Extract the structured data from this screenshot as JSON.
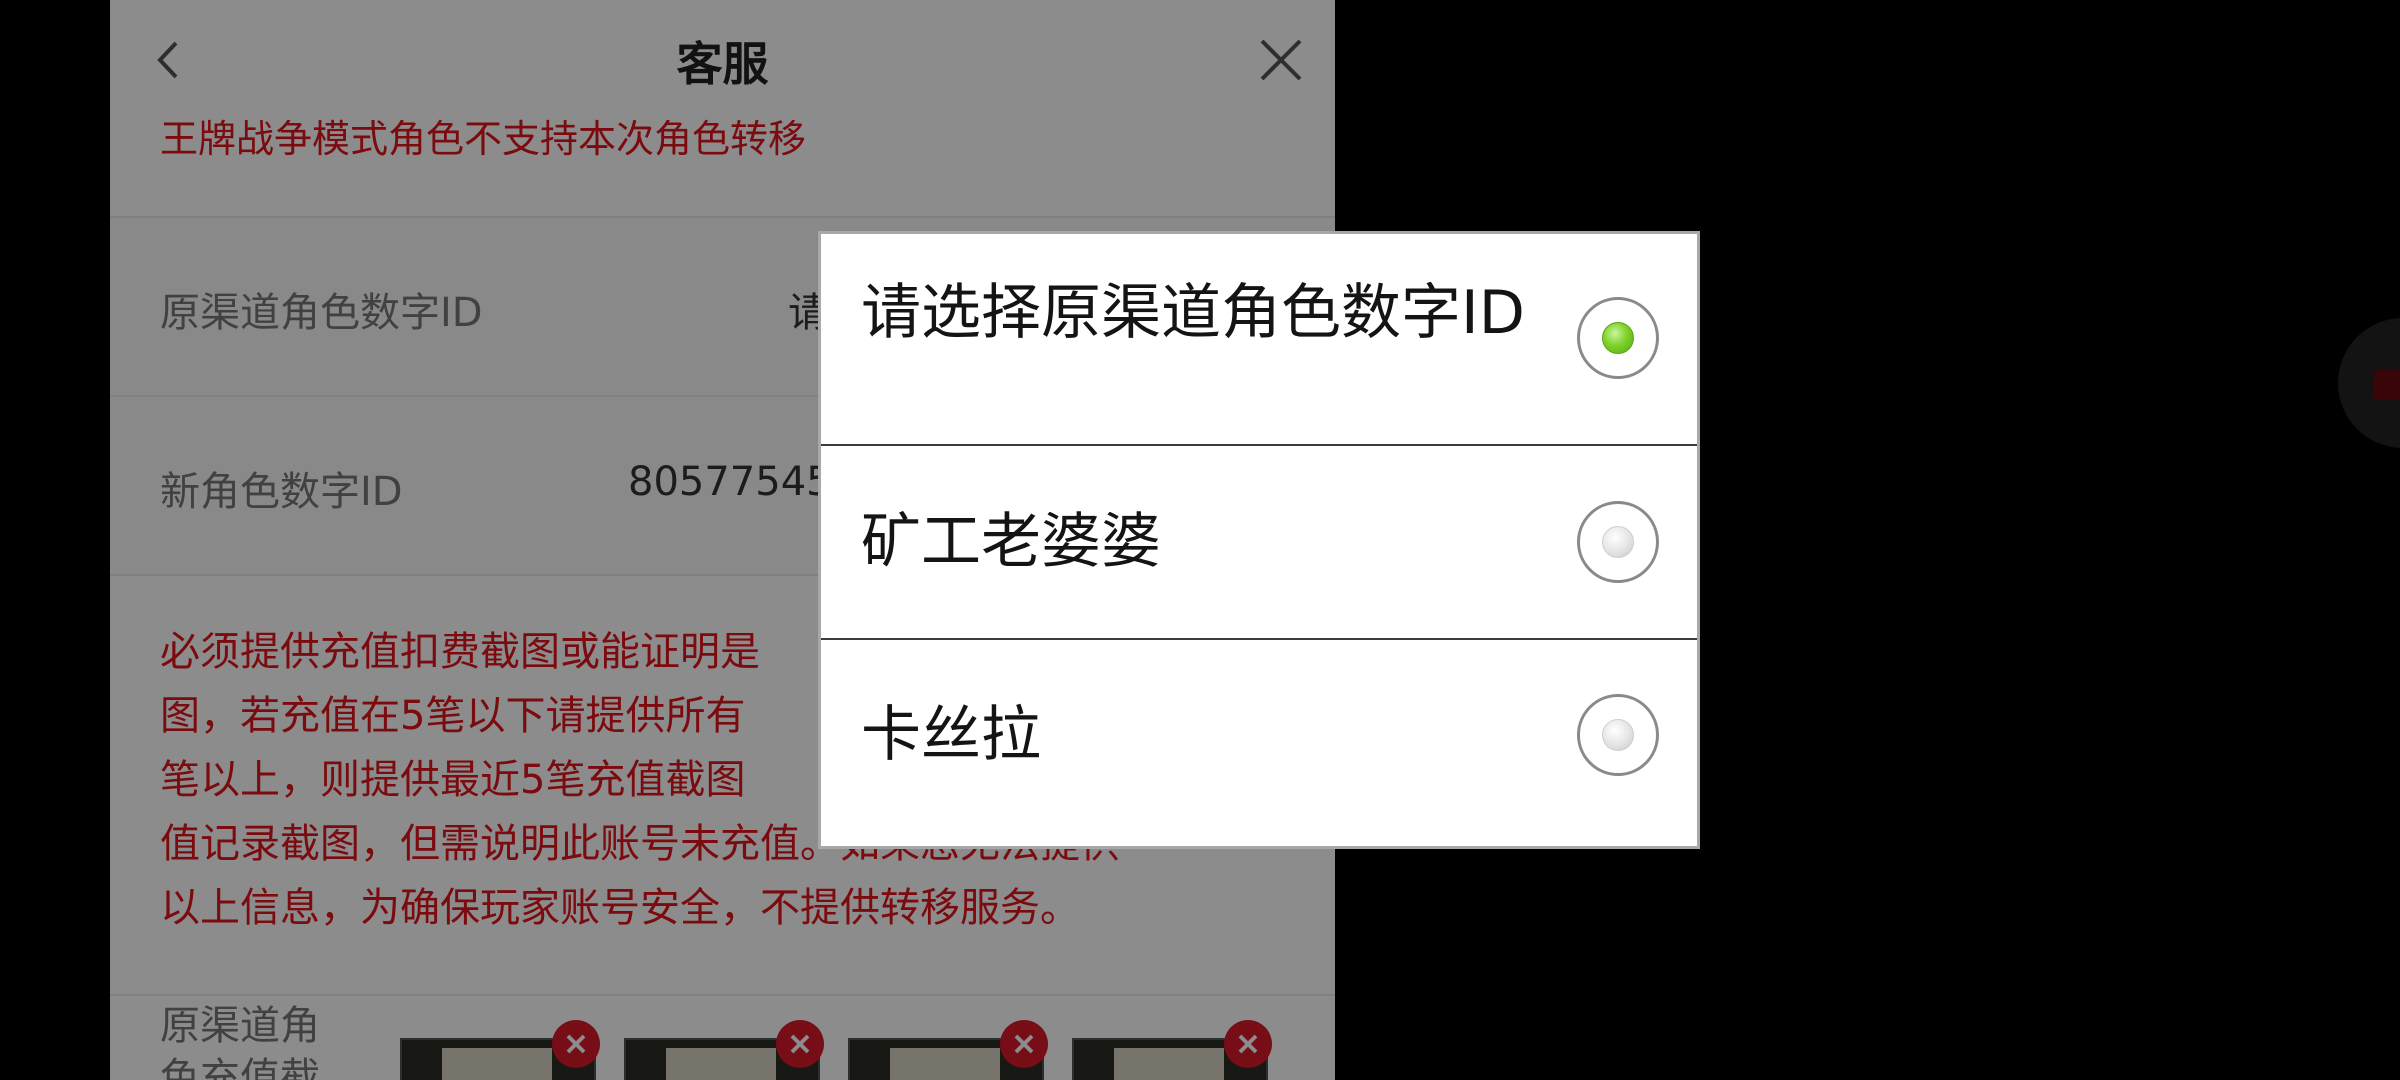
{
  "header": {
    "title": "客服"
  },
  "notice_top": "王牌战争模式角色不支持本次角色转移",
  "form": {
    "original_id_label": "原渠道角色数字ID",
    "original_id_value": "请",
    "new_id_label": "新角色数字ID",
    "new_id_value": "80577545"
  },
  "notice_block": {
    "lines": [
      "必须提供充值扣费截图或能证明是",
      "图，若充值在5笔以下请提供所有",
      "笔以上，则提供最近5笔充值截图",
      "值记录截图，但需说明此账号未充值。如果您无法提供",
      "以上信息，为确保玩家账号安全，不提供转移服务。"
    ]
  },
  "upload": {
    "label": "原渠道角色充值截"
  },
  "dialog": {
    "options": [
      {
        "label": "请选择原渠道角色数字ID",
        "selected": true
      },
      {
        "label": "矿工老婆婆",
        "selected": false
      },
      {
        "label": "卡丝拉",
        "selected": false
      }
    ]
  },
  "colors": {
    "notice_red": "#e0151b",
    "radio_selected": "#7fd22b",
    "delete_badge": "#d8182a"
  },
  "icons": {
    "back": "chevron-left-icon",
    "close": "close-icon",
    "delete": "close-circle-icon"
  }
}
